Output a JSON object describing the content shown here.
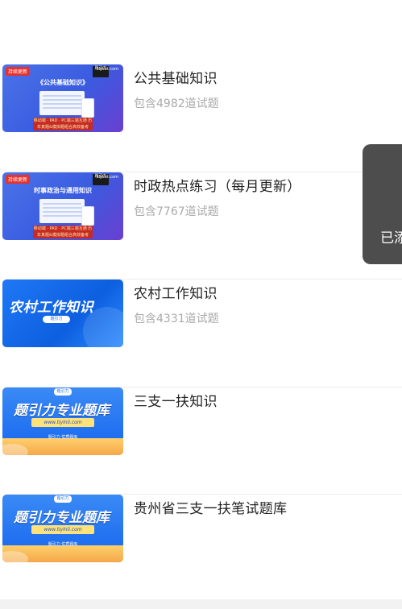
{
  "items": [
    {
      "title": "公共基础知识",
      "subtitle": "包含4982道试题",
      "thumb": {
        "style": "screen",
        "tag": "持续更新",
        "url": "tiylint.com",
        "logo": "题引力",
        "heading": "《公共基础知识》",
        "band": "移动端 · PAD · PC端三端互通 历年真题&模拟题组合高效备考"
      }
    },
    {
      "title": "时政热点练习（每月更新）",
      "subtitle": "包含7767道试题",
      "thumb": {
        "style": "screen",
        "tag": "持续更新",
        "url": "tiylint.com",
        "logo": "题引力",
        "heading": "时事政治与通用知识",
        "band": "移动端 · PAD · PC端三端互通 历年真题&模拟题组合高效备考"
      }
    },
    {
      "title": "农村工作知识",
      "subtitle": "包含4331道试题",
      "thumb": {
        "style": "blue",
        "heading": "农村工作知识",
        "chip": "题引力"
      }
    },
    {
      "title": "三支一扶知识",
      "subtitle": "",
      "thumb": {
        "style": "bank",
        "logo": "题引力",
        "heading": "题引力专业题库",
        "url": "www.tiylnli.com",
        "foot": "题引力 优质题库"
      }
    },
    {
      "title": "贵州省三支一扶笔试题库",
      "subtitle": "",
      "thumb": {
        "style": "bank",
        "logo": "题引力",
        "heading": "题引力专业题库",
        "url": "www.tiylnli.com",
        "foot": "题引力 优质题库"
      }
    }
  ],
  "toast": {
    "text": "已添"
  }
}
